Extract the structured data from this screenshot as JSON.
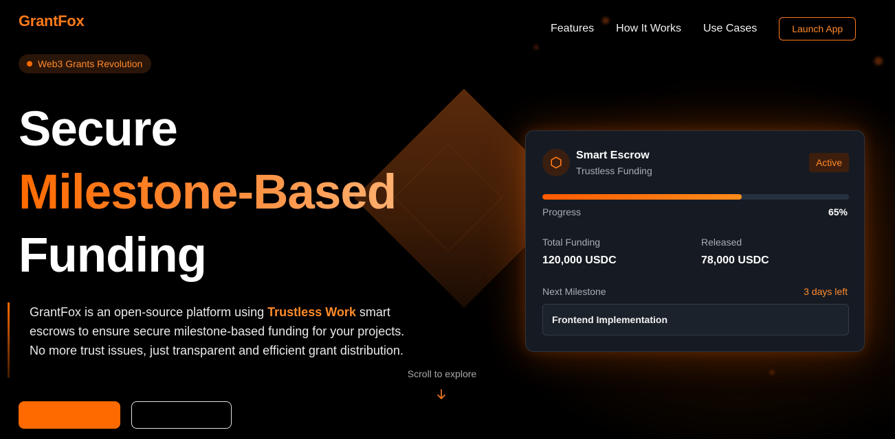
{
  "header": {
    "logo": "GrantFox",
    "nav": [
      "Features",
      "How It Works",
      "Use Cases"
    ],
    "launch_label": "Launch App"
  },
  "hero": {
    "badge": "Web3 Grants Revolution",
    "headline": {
      "line1": "Secure",
      "line2": "Milestone-Based",
      "line3": "Funding"
    },
    "description": {
      "before": "GrantFox is an open-source platform using ",
      "highlight": "Trustless Work",
      "after": " smart escrows to ensure secure milestone-based funding for your projects. No more trust issues, just transparent and efficient grant distribution."
    },
    "scroll_hint": "Scroll to explore"
  },
  "escrow_card": {
    "icon": "hexagon-icon",
    "title": "Smart Escrow",
    "subtitle": "Trustless Funding",
    "status": "Active",
    "progress_label": "Progress",
    "progress_value": "65%",
    "progress_fraction": 0.65,
    "total_funding_label": "Total Funding",
    "total_funding_value": "120,000 USDC",
    "released_label": "Released",
    "released_value": "78,000 USDC",
    "next_milestone_label": "Next Milestone",
    "next_milestone_due": "3 days left",
    "next_milestone_name": "Frontend Implementation"
  },
  "colors": {
    "accent": "#ff6a00",
    "accent_light": "#ff8a2a",
    "background": "#000000",
    "card_bg": "#161b23"
  }
}
